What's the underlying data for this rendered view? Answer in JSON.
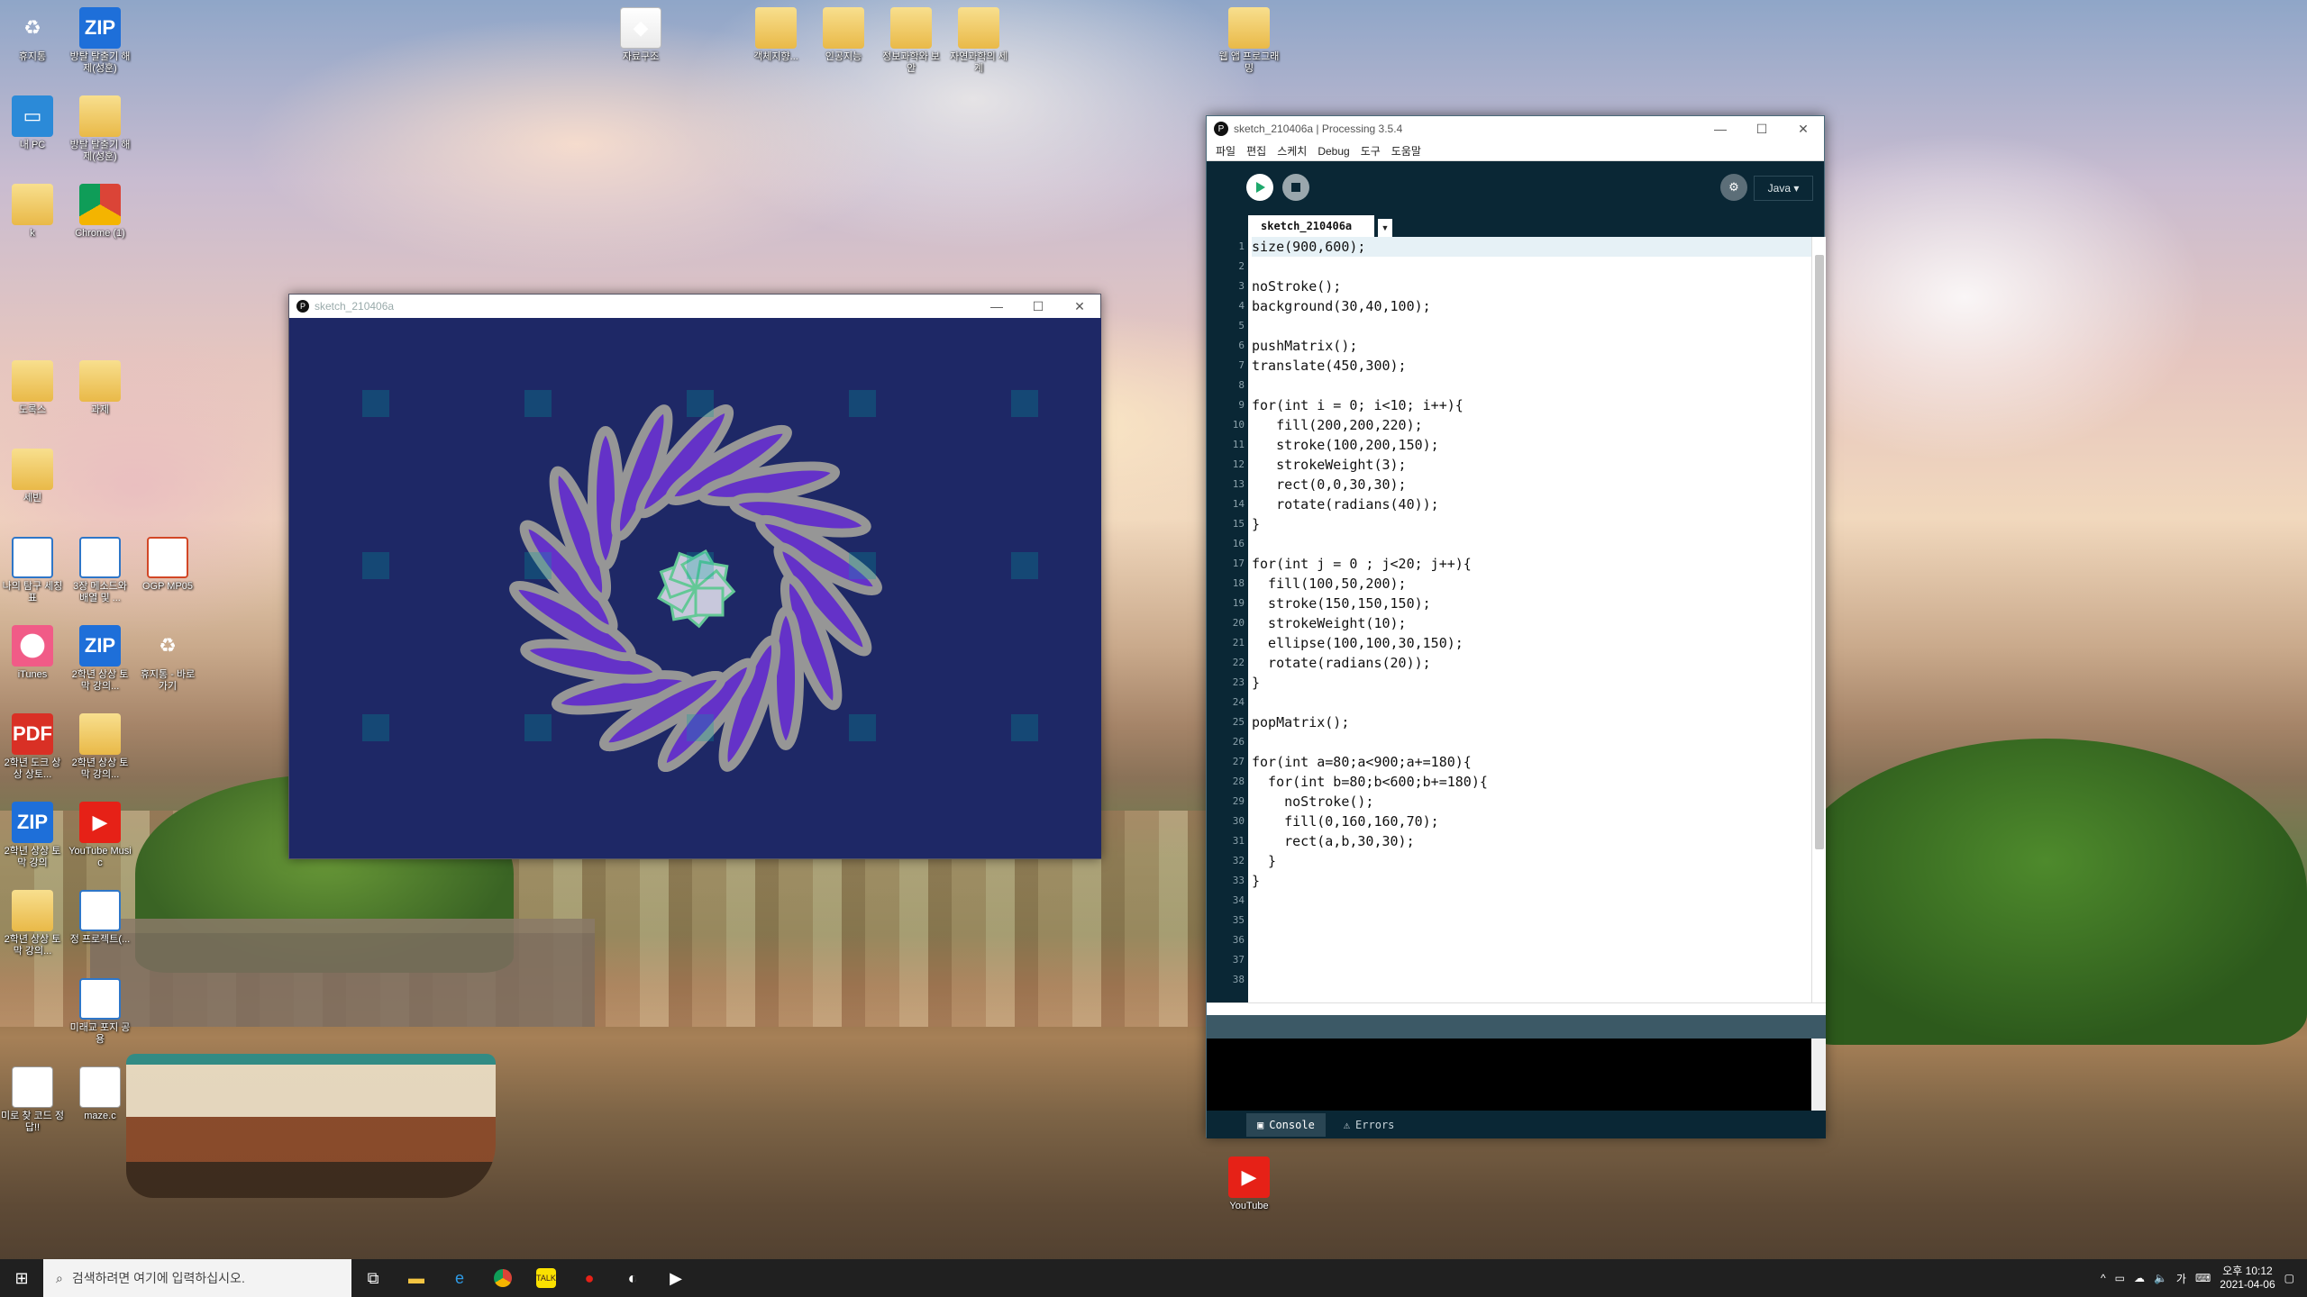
{
  "desktop": {
    "icons": [
      {
        "label": "휴지통",
        "icon": "recycle-bin-icon",
        "glyph": "♻",
        "cls": "g-recycle"
      },
      {
        "label": "방탈 탈출기 해제(성훈)",
        "icon": "zip-icon",
        "glyph": "ZIP",
        "cls": "g-zip"
      },
      {
        "label": "내 PC",
        "icon": "pc-icon",
        "glyph": "▭",
        "cls": "g-pc"
      },
      {
        "label": "방탈 탈출기 해제(성훈)",
        "icon": "folder-icon",
        "glyph": "",
        "cls": "g-folder"
      },
      {
        "label": "k",
        "icon": "user-folder-icon",
        "glyph": "",
        "cls": "g-folder"
      },
      {
        "label": "Chrome (1)",
        "icon": "chrome-icon",
        "glyph": "",
        "cls": "g-chrome"
      },
      {
        "label": "도록스",
        "icon": "folder-icon",
        "glyph": "",
        "cls": "g-folder"
      },
      {
        "label": "과제",
        "icon": "folder-icon",
        "glyph": "",
        "cls": "g-folder"
      },
      {
        "label": "세빈",
        "icon": "folder-icon",
        "glyph": "",
        "cls": "g-folder"
      },
      {
        "label": "나의 탐구 세칭표",
        "icon": "hwp-icon",
        "glyph": "ㅎ",
        "cls": "g-hwp"
      },
      {
        "label": "3장 메소드와 배열 및 ...",
        "icon": "hwp-icon",
        "glyph": "ㅎ",
        "cls": "g-hwp"
      },
      {
        "label": "OGP MP05",
        "icon": "ppt-icon",
        "glyph": "P",
        "cls": "g-ppt"
      },
      {
        "label": "iTunes",
        "icon": "itunes-icon",
        "glyph": "♫",
        "cls": "g-itunes"
      },
      {
        "label": "2학년 상상 토막 강의...",
        "icon": "zip-icon",
        "glyph": "ZIP",
        "cls": "g-zip"
      },
      {
        "label": "휴지통 - 바로 가기",
        "icon": "recycle-bin-icon",
        "glyph": "♻",
        "cls": "g-recycle"
      },
      {
        "label": "2학년 도크 상상 상토...",
        "icon": "pdf-icon",
        "glyph": "PDF",
        "cls": "g-pdf"
      },
      {
        "label": "2학년 상상 토막 강의...",
        "icon": "folder-icon",
        "glyph": "",
        "cls": "g-folder"
      },
      {
        "label": "2학년 상상 토막 강의",
        "icon": "zip-icon",
        "glyph": "ZIP",
        "cls": "g-zip"
      },
      {
        "label": "YouTube Music",
        "icon": "youtube-music-icon",
        "glyph": "▶",
        "cls": "g-yt"
      },
      {
        "label": "2학년 상상 토막 강의...",
        "icon": "folder-icon",
        "glyph": "",
        "cls": "g-folder"
      },
      {
        "label": "정 프로젝트(...",
        "icon": "hwp-icon",
        "glyph": "ㅎ",
        "cls": "g-hwp"
      },
      {
        "label": "미래교 포지 공용",
        "icon": "hwp-icon",
        "glyph": "ㅎ",
        "cls": "g-hwp"
      },
      {
        "label": "미로 찾 코드 정답!!",
        "icon": "file-icon",
        "glyph": "",
        "cls": "g-file"
      },
      {
        "label": "maze.c",
        "icon": "c-file-icon",
        "glyph": "C",
        "cls": "g-file"
      },
      {
        "label": "자료구조",
        "icon": "visual-studio-folder-icon",
        "glyph": "◆",
        "cls": "g-doc"
      },
      {
        "label": "객체지향...",
        "icon": "folder-icon",
        "glyph": "",
        "cls": "g-folder"
      },
      {
        "label": "인공지능",
        "icon": "folder-icon",
        "glyph": "",
        "cls": "g-folder"
      },
      {
        "label": "정보과학와 보안",
        "icon": "folder-icon",
        "glyph": "",
        "cls": "g-folder"
      },
      {
        "label": "자연과학의 세계",
        "icon": "folder-icon",
        "glyph": "",
        "cls": "g-folder"
      },
      {
        "label": "웹 앱 프로그래밍",
        "icon": "folder-icon",
        "glyph": "",
        "cls": "g-folder"
      },
      {
        "label": "YouTube",
        "icon": "youtube-icon",
        "glyph": "▶",
        "cls": "g-yt"
      }
    ]
  },
  "sketch_window": {
    "title": "sketch_210406a",
    "background": "#1e2866",
    "petal_fill": "#6432c8",
    "petal_stroke": "#969696",
    "center_fill": "#c8c8dc",
    "center_stroke": "#64c896",
    "square_fill": "#00a0a0"
  },
  "ide": {
    "title": "sketch_210406a | Processing 3.5.4",
    "menu": [
      "파일",
      "편집",
      "스케치",
      "Debug",
      "도구",
      "도움말"
    ],
    "mode": "Java ▾",
    "tab": "sketch_210406a",
    "code_lines": [
      "size(900,600);",
      "",
      "noStroke();",
      "background(30,40,100);",
      "",
      "pushMatrix();",
      "translate(450,300);",
      "",
      "for(int i = 0; i<10; i++){",
      "   fill(200,200,220);",
      "   stroke(100,200,150);",
      "   strokeWeight(3);",
      "   rect(0,0,30,30);",
      "   rotate(radians(40));",
      "}",
      "",
      "for(int j = 0 ; j<20; j++){",
      "  fill(100,50,200);",
      "  stroke(150,150,150);",
      "  strokeWeight(10);",
      "  ellipse(100,100,30,150);",
      "  rotate(radians(20));",
      "}",
      "",
      "popMatrix();",
      "",
      "for(int a=80;a<900;a+=180){",
      "  for(int b=80;b<600;b+=180){",
      "    noStroke();",
      "    fill(0,160,160,70);",
      "    rect(a,b,30,30);",
      "  }",
      "}",
      "",
      "",
      "",
      "",
      ""
    ],
    "console_tabs": [
      "Console",
      "Errors"
    ]
  },
  "taskbar": {
    "search_placeholder": "검색하려면 여기에 입력하십시오.",
    "tray_lang": "가",
    "time": "오후 10:12",
    "date": "2021-04-06"
  }
}
